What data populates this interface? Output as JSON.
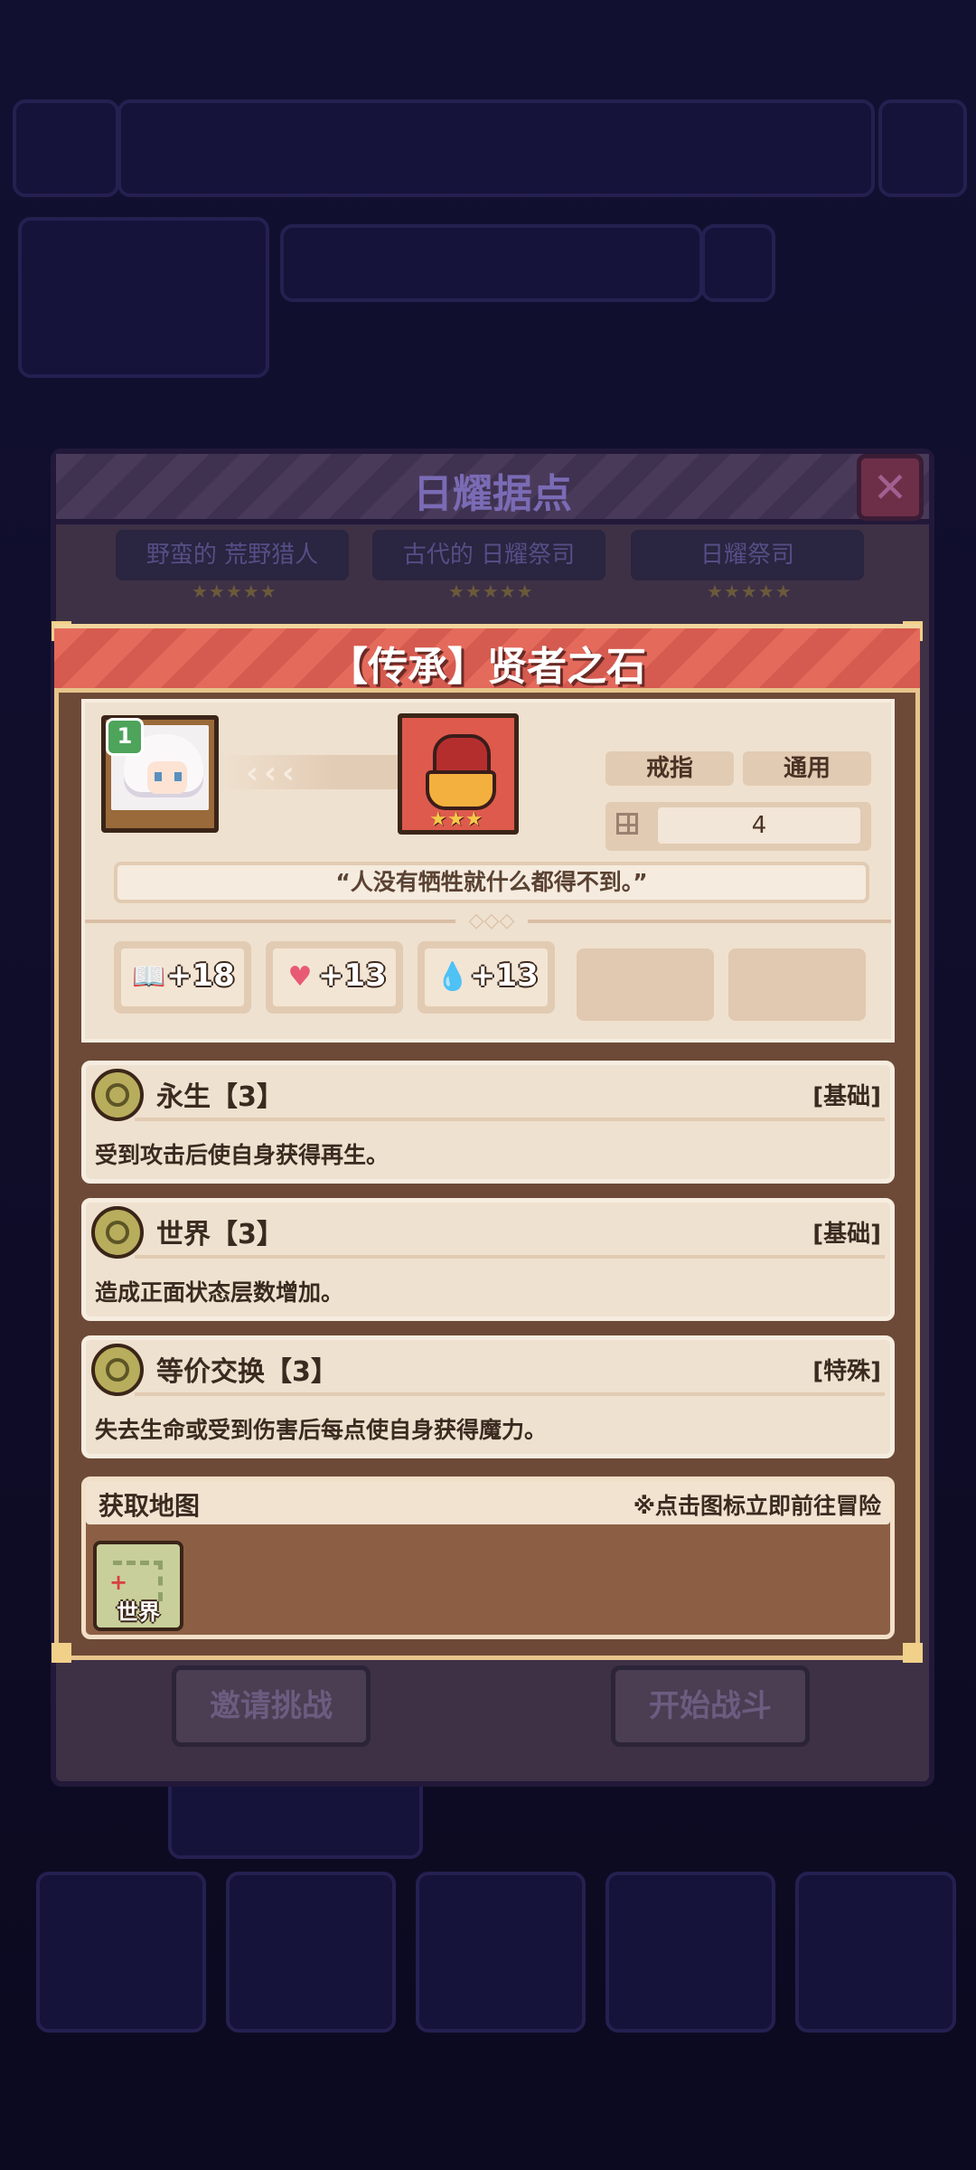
{
  "background": {
    "stronghold_title": "日耀据点",
    "enemies": [
      {
        "name": "野蛮的 荒野猎人",
        "stars": "★★★★★"
      },
      {
        "name": "古代的 日耀祭司",
        "stars": "★★★★★"
      },
      {
        "name": "日耀祭司",
        "stars": "★★★★★"
      }
    ],
    "invite_button": "邀请挑战",
    "start_button": "开始战斗",
    "close_symbol": "✕"
  },
  "item": {
    "title": "【传承】贤者之石",
    "hero_level": "1",
    "rarity_stars": "★★★",
    "slot_tag": "戒指",
    "class_tag": "通用",
    "count": "4",
    "quote": "“人没有牺牲就什么都得不到。”",
    "stats": [
      {
        "icon": "book-icon",
        "glyph": "📖",
        "value": "+18"
      },
      {
        "icon": "heart-icon",
        "glyph": "♥",
        "value": "+13"
      },
      {
        "icon": "water-drop-icon",
        "glyph": "💧",
        "value": "+13"
      }
    ]
  },
  "skills": [
    {
      "name": "永生【3】",
      "type": "[基础]",
      "desc": "受到攻击后使自身获得再生。"
    },
    {
      "name": "世界【3】",
      "type": "[基础]",
      "desc": "造成正面状态层数增加。"
    },
    {
      "name": "等价交换【3】",
      "type": "[特殊]",
      "desc": "失去生命或受到伤害后每点使自身获得魔力。"
    }
  ],
  "map_section": {
    "title": "获取地图",
    "hint": "※点击图标立即前往冒险",
    "maps": [
      {
        "label": "世界"
      }
    ]
  },
  "colors": {
    "header_red": "#e46a5c",
    "frame_gold": "#e7c48b",
    "modal_brown": "#6d4a37",
    "panel_cream": "#efe1cf"
  }
}
